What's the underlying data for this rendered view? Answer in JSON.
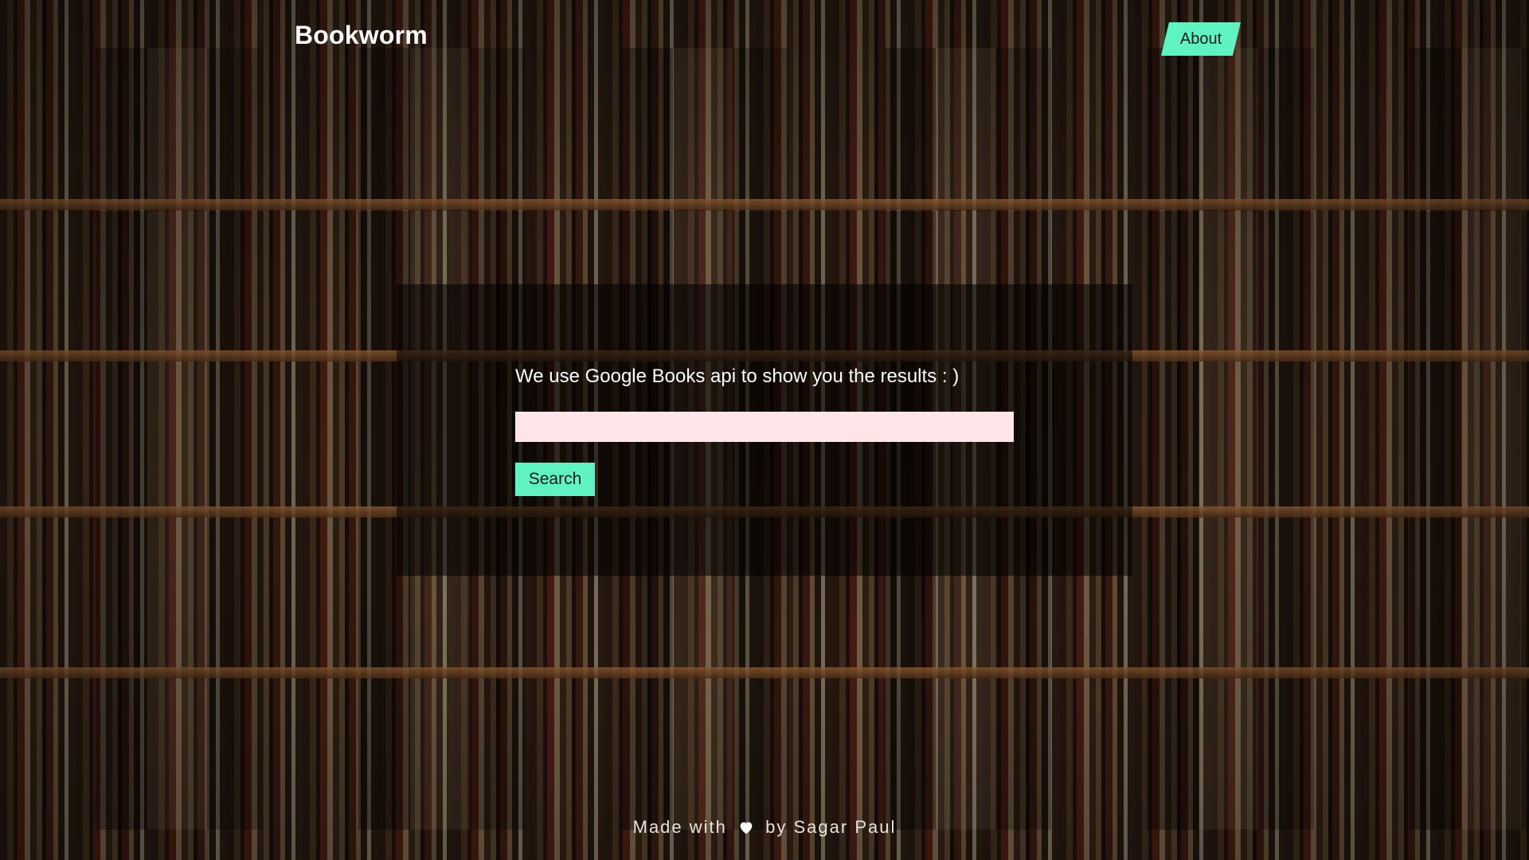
{
  "header": {
    "brand": "Bookworm",
    "about_label": "About"
  },
  "main": {
    "tagline": "We use Google Books api to show you the results : )",
    "search_value": "",
    "search_placeholder": "",
    "search_button_label": "Search"
  },
  "footer": {
    "prefix": "Made with",
    "icon": "heart-icon",
    "suffix": "by Sagar Paul"
  },
  "colors": {
    "accent": "#5ff2c2",
    "input_bg": "#ffe5e7",
    "panel_overlay": "rgba(0,0,0,0.55)"
  }
}
